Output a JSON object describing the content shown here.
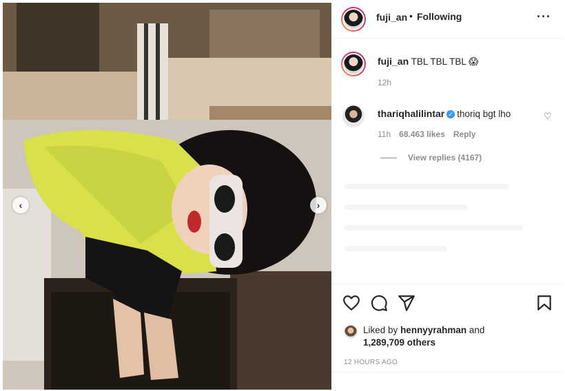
{
  "post": {
    "author": "fuji_an",
    "separator": "•",
    "follow_status": "Following",
    "more_icon": "more-horizontal-icon"
  },
  "caption": {
    "username": "fuji_an",
    "text": "TBL TBL TBL 😱",
    "time": "12h"
  },
  "comment": {
    "username": "thariqhalilintar",
    "verified": true,
    "text": "thoriq bgt lho",
    "time": "11h",
    "likes": "68.463 likes",
    "reply_label": "Reply",
    "view_replies": "View replies (4167)"
  },
  "likes": {
    "prefix": "Liked by",
    "user": "hennyyrahman",
    "and": "and",
    "others": "1,289,709 others"
  },
  "timestamp": "12 HOURS AGO",
  "icons": [
    "heart-icon",
    "comment-icon",
    "share-icon",
    "bookmark-icon",
    "chevron-left-icon",
    "chevron-right-icon"
  ]
}
